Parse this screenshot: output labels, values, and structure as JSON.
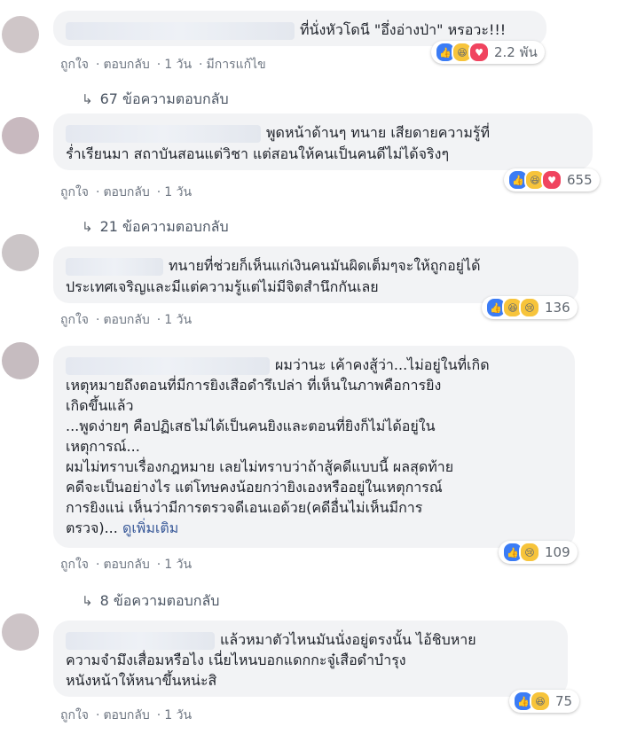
{
  "comments": [
    {
      "lines": [
        "ที่นั่งหัวโดนี \"อึ่งอ่างป่า\" หรอวะ!!!"
      ],
      "actions": {
        "like": "ถูกใจ",
        "reply": "ตอบกลับ",
        "time": "1 วัน",
        "edited": "มีการแก้ไข"
      },
      "reactions": {
        "icons": [
          "like-icon",
          "haha-icon",
          "love-icon"
        ],
        "count": "2.2 พัน"
      },
      "replies": "67 ข้อความตอบกลับ"
    },
    {
      "lines": [
        "พูดหน้าด้านๆ ทนาย เสียดายความรู้ที่",
        "ร่ำเรียนมา สถาบันสอนแต่วิชา แต่สอนให้คนเป็นคนดีไม่ได้จริงๆ"
      ],
      "actions": {
        "like": "ถูกใจ",
        "reply": "ตอบกลับ",
        "time": "1 วัน"
      },
      "reactions": {
        "icons": [
          "like-icon",
          "haha-icon",
          "love-icon"
        ],
        "count": "655"
      },
      "replies": "21 ข้อความตอบกลับ"
    },
    {
      "lines": [
        "ทนายที่ช่วยก็เห็นแก่เงินคนมันผิดเต็มๆจะให้ถูกอยู่ได้",
        "ประเทศเจริญและมีแต่ความรู้แต่ไม่มีจิตสำนึกกันเลย"
      ],
      "actions": {
        "like": "ถูกใจ",
        "reply": "ตอบกลับ",
        "time": "1 วัน"
      },
      "reactions": {
        "icons": [
          "like-icon",
          "haha-icon",
          "sad-icon"
        ],
        "count": "136"
      }
    },
    {
      "lines": [
        "ผมว่านะ เค้าคงสู้ว่า...ไม่อยู่ในที่เกิด",
        "เหตุหมายถึงตอนที่มีการยิงเสือดำรึเปล่า ที่เห็นในภาพคือการยิง",
        "เกิดขึ้นแล้ว",
        "...พูดง่ายๆ คือปฏิเสธไม่ได้เป็นคนยิงและตอนที่ยิงก็ไม่ได้อยู่ใน",
        "เหตุการณ์...",
        "ผมไม่ทราบเรื่องกฎหมาย เลยไม่ทราบว่าถ้าสู้คดีแบบนี้ ผลสุดท้าย",
        "คดีจะเป็นอย่างไร แต่โทษคงน้อยกว่ายิงเองหรืออยู่ในเหตุการณ์",
        "การยิงแน่ เห็นว่ามีการตรวจดีเอนเอด้วย(คดีอื่นไม่เห็นมีการ",
        "ตรวจ)..."
      ],
      "see_more": "ดูเพิ่มเติม",
      "actions": {
        "like": "ถูกใจ",
        "reply": "ตอบกลับ",
        "time": "1 วัน"
      },
      "reactions": {
        "icons": [
          "like-icon",
          "sad-icon"
        ],
        "count": "109"
      },
      "replies": "8 ข้อความตอบกลับ"
    },
    {
      "lines": [
        "แล้วหมาตัวไหนมันนั่งอยู่ตรงนั้น ไอ้ชิบหาย",
        "ความจำมึงเสื่อมหรือไง เนี่ยไหนบอกแดกกะจู๋เสือดำบำรุง",
        "หนังหน้าให้หนาขึ้นหน่ะสิ"
      ],
      "actions": {
        "like": "ถูกใจ",
        "reply": "ตอบกลับ",
        "time": "1 วัน"
      },
      "reactions": {
        "icons": [
          "like-icon",
          "haha-icon"
        ],
        "count": "75"
      }
    }
  ]
}
